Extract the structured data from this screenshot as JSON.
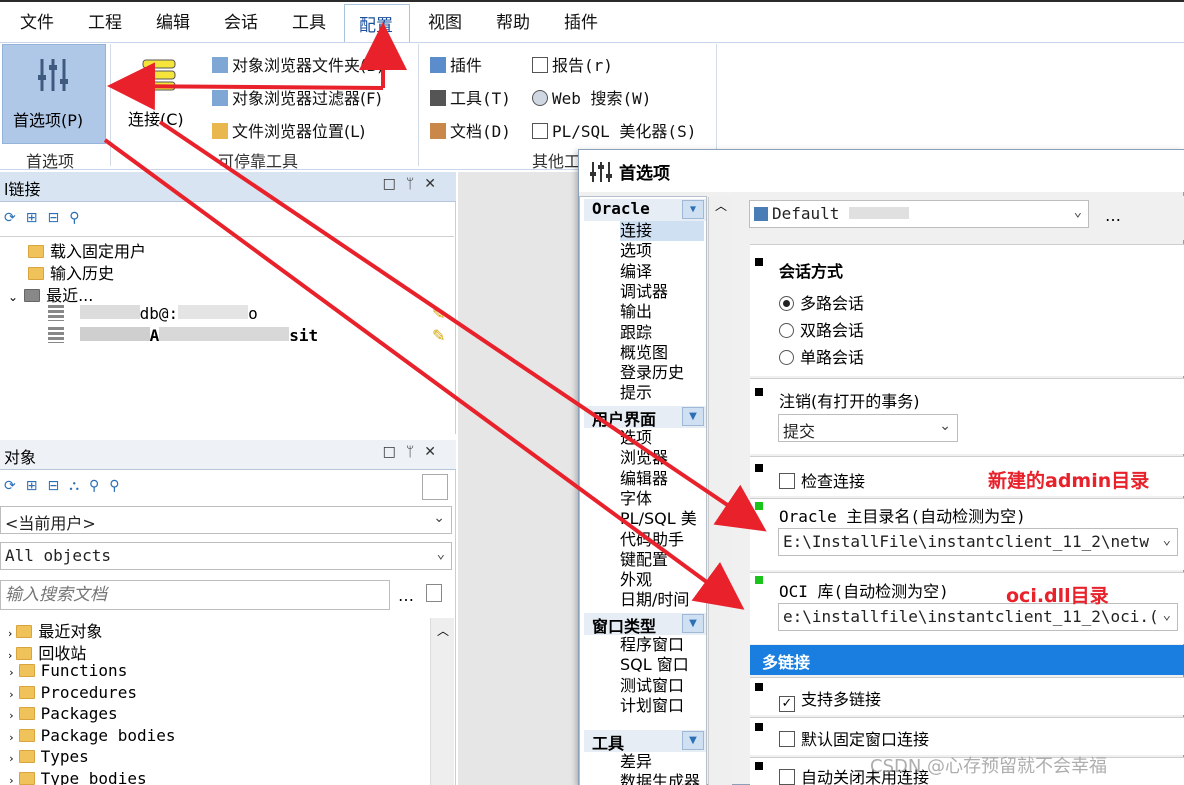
{
  "menubar": {
    "items": [
      "文件",
      "工程",
      "编辑",
      "会话",
      "工具",
      "配置",
      "视图",
      "帮助",
      "插件"
    ]
  },
  "ribbon": {
    "prefs_label": "首选项(P)",
    "prefs_group": "首选项",
    "connect_label": "连接(C)",
    "dock1": "对象浏览器文件夹(B)",
    "dock2": "对象浏览器过滤器(F)",
    "dock3": "文件浏览器位置(L)",
    "dock_group": "可停靠工具",
    "other1": "插件",
    "other2": "工具(T)",
    "other3": "文档(D)",
    "other4": "报告(r)",
    "other5": "Web 搜索(W)",
    "other6": "PL/SQL 美化器(S)",
    "other_group": "其他工"
  },
  "conn_panel": {
    "title": "l链接",
    "items": [
      "载入固定用户",
      "输入历史",
      "最近..."
    ],
    "recent": [
      "db@:",
      "o",
      "A",
      "sit"
    ]
  },
  "obj_panel": {
    "title": "对象",
    "user_combo": "<当前用户>",
    "type_combo": "All objects",
    "search_placeholder": "输入搜索文档",
    "items": [
      "最近对象",
      "回收站",
      "Functions",
      "Procedures",
      "Packages",
      "Package bodies",
      "Types",
      "Type bodies"
    ]
  },
  "dialog": {
    "title": "首选项",
    "profile": "Default",
    "nav": {
      "oracle": {
        "header": "Oracle",
        "items": [
          "连接",
          "选项",
          "编译",
          "调试器",
          "输出",
          "跟踪",
          "概览图",
          "登录历史",
          "提示"
        ]
      },
      "ui": {
        "header": "用户界面",
        "items": [
          "选项",
          "浏览器",
          "编辑器",
          "字体",
          "PL/SQL 美",
          "代码助手",
          "键配置",
          "外观",
          "日期/时间"
        ]
      },
      "win": {
        "header": "窗口类型",
        "items": [
          "程序窗口",
          "SQL 窗口",
          "测试窗口",
          "计划窗口"
        ]
      },
      "tools": {
        "header": "工具",
        "items": [
          "差异",
          "数据生成器"
        ]
      }
    },
    "session_mode": {
      "title": "会话方式",
      "options": [
        "多路会话",
        "双路会话",
        "单路会话"
      ],
      "selected": 0
    },
    "logoff": {
      "title": "注销(有打开的事务)",
      "value": "提交"
    },
    "check_conn": "检查连接",
    "oracle_home": {
      "label": "Oracle 主目录名(自动检测为空)",
      "value": "E:\\InstallFile\\instantclient_11_2\\netw"
    },
    "oci": {
      "label": "OCI 库(自动检测为空)",
      "value": "e:\\installfile\\instantclient_11_2\\oci.("
    },
    "multi": {
      "header": "多链接",
      "support": "支持多链接",
      "default_fixed": "默认固定窗口连接",
      "auto_close": "自动关闭未用连接"
    }
  },
  "annotations": {
    "admin_dir": "新建的admin目录",
    "oci_dir": "oci.dll目录"
  },
  "watermark": "CSDN @心存预留就不会幸福",
  "colors": {
    "accent": "#1a7ee0",
    "arrow": "#e8212b",
    "selected": "#afc8e8"
  }
}
